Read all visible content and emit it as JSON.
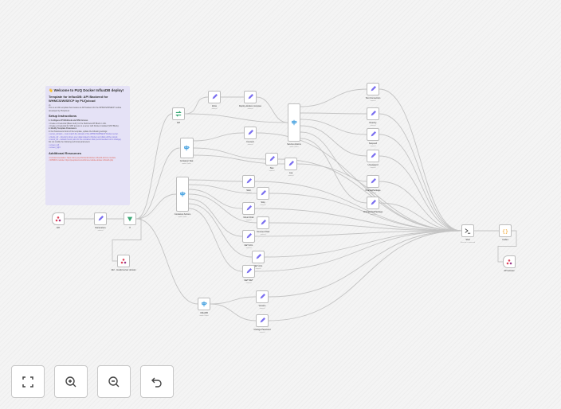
{
  "sticky_note": {
    "title": "👋 Welcome to PUQ Docker InfluxDB deploy!",
    "subtitle": "Template for InfluxDB: API Backend for WHMCS/WISECP by PUQcloud",
    "version": "v1",
    "intro": "This is an n8n template that creates an API backend for the WHMCS/WISECP module developed by PUQcloud.",
    "setup_heading": "Setup Instructions",
    "step1": "1. Configure API Webhook and SSH Access",
    "step1a": "• Create a Credential (Basic Auth) for the Webhook API Block in n8n.",
    "step1b": "• Create a Credential for SSH access to a server with Docker installed (SSH Block).",
    "step2": "2. Modify Template Parameters",
    "step2a": "In the Parameters block of the template, update the following settings:",
    "param1": "• server_domain – must match the domain of the WHMCS/WISECP Docker server.",
    "param2": "• clients_dir – directory where user data related to Docker and disks will be stored.",
    "param3": "• mount_dir – default mount point for the container disk (recommended not to change).",
    "donot": "Do not modify the following technical parameters:",
    "param4": "• screen_left",
    "param5": "• screen_right",
    "resources_heading": "Additional Resources",
    "res1": "• Full documentation: https://doc.puq.info/books/docker-influxdb-whmcs-module",
    "res2": "• WHMCS module: https://puqcloud.com/whmcs-module-docker-influxdb.php"
  },
  "colors": {
    "accent": "#7b6ff0",
    "trigger": "#e0445a",
    "switch": "#3aa876",
    "route": "#4aa3e0",
    "code": "#f0a020"
  },
  "nodes": [
    {
      "id": "api_hook",
      "label": "API",
      "sub": "",
      "icon": "webhook-icon"
    },
    {
      "id": "params",
      "label": "Parameters",
      "sub": "manual",
      "icon": "pencil-icon"
    },
    {
      "id": "if",
      "label": "If",
      "sub": "",
      "icon": "if-icon"
    },
    {
      "id": "invalid",
      "label": "422 - Invalid server domain",
      "sub": "",
      "icon": "webhook-icon"
    },
    {
      "id": "api_switch",
      "label": "API",
      "sub": "",
      "icon": "switch-icon"
    },
    {
      "id": "container_info",
      "label": "Container Stat",
      "sub": "mode: Rules",
      "icon": "route-icon"
    },
    {
      "id": "container_actions",
      "label": "Container Actions",
      "sub": "mode: Rules",
      "icon": "route-icon"
    },
    {
      "id": "inline",
      "label": "Inline",
      "sub": "manual",
      "icon": "pencil-icon"
    },
    {
      "id": "deploy",
      "label": "Deploy-docker-compose",
      "sub": "manual",
      "icon": "pencil-icon"
    },
    {
      "id": "server_actions",
      "label": "Service Actions",
      "sub": "mode: Rules",
      "icon": "route-icon"
    },
    {
      "id": "connect",
      "label": "Connect",
      "sub": "manual",
      "icon": "pencil-icon"
    },
    {
      "id": "stat",
      "label": "Stat",
      "sub": "manual",
      "icon": "pencil-icon"
    },
    {
      "id": "log",
      "label": "Log",
      "sub": "manual",
      "icon": "pencil-icon"
    },
    {
      "id": "start",
      "label": "Start",
      "sub": "manual",
      "icon": "pencil-icon"
    },
    {
      "id": "stop",
      "label": "Stop",
      "sub": "manual",
      "icon": "pencil-icon"
    },
    {
      "id": "mount_disk",
      "label": "Mount Disk",
      "sub": "manual",
      "icon": "pencil-icon"
    },
    {
      "id": "unmount",
      "label": "Unmount Disk",
      "sub": "manual",
      "icon": "pencil-icon"
    },
    {
      "id": "get_acl",
      "label": "GET ACL",
      "sub": "manual",
      "icon": "pencil-icon"
    },
    {
      "id": "set_acl",
      "label": "SET ACL",
      "sub": "manual",
      "icon": "pencil-icon"
    },
    {
      "id": "get_net",
      "label": "GET NET",
      "sub": "manual",
      "icon": "pencil-icon"
    },
    {
      "id": "influxdb",
      "label": "InfluxDB",
      "sub": "mode: Rules",
      "icon": "route-icon"
    },
    {
      "id": "version",
      "label": "Version",
      "sub": "manual",
      "icon": "pencil-icon"
    },
    {
      "id": "change_pw",
      "label": "Change Password",
      "sub": "manual",
      "icon": "pencil-icon"
    },
    {
      "id": "test_conn",
      "label": "Test Connection",
      "sub": "manual",
      "icon": "pencil-icon"
    },
    {
      "id": "destroy",
      "label": "Destroy",
      "sub": "manual",
      "icon": "pencil-icon"
    },
    {
      "id": "suspend",
      "label": "Suspend",
      "sub": "manual",
      "icon": "pencil-icon"
    },
    {
      "id": "unsuspend",
      "label": "Unsuspend",
      "sub": "manual",
      "icon": "pencil-icon"
    },
    {
      "id": "change_pkg",
      "label": "ChangePackage",
      "sub": "manual",
      "icon": "pencil-icon"
    },
    {
      "id": "change_pkg2",
      "label": "ChangeOwnPackage",
      "sub": "manual",
      "icon": "pencil-icon"
    },
    {
      "id": "ssh",
      "label": "SSH",
      "sub": "Execute a command",
      "icon": "terminal-icon"
    },
    {
      "id": "code",
      "label": "Code1",
      "sub": "",
      "icon": "code-icon"
    },
    {
      "id": "answer",
      "label": "API answer",
      "sub": "",
      "icon": "webhook-icon"
    }
  ],
  "edges": [
    [
      "api_hook",
      "params"
    ],
    [
      "params",
      "if"
    ],
    [
      "if",
      "invalid"
    ],
    [
      "if",
      "api_switch"
    ],
    [
      "if",
      "container_info"
    ],
    [
      "if",
      "container_actions"
    ],
    [
      "if",
      "influxdb"
    ],
    [
      "api_switch",
      "inline"
    ],
    [
      "inline",
      "deploy"
    ],
    [
      "deploy",
      "server_actions"
    ],
    [
      "api_switch",
      "server_actions"
    ],
    [
      "container_info",
      "connect"
    ],
    [
      "container_info",
      "stat"
    ],
    [
      "container_info",
      "log"
    ],
    [
      "container_actions",
      "start"
    ],
    [
      "container_actions",
      "stop"
    ],
    [
      "container_actions",
      "mount_disk"
    ],
    [
      "container_actions",
      "unmount"
    ],
    [
      "container_actions",
      "get_acl"
    ],
    [
      "container_actions",
      "set_acl"
    ],
    [
      "container_actions",
      "get_net"
    ],
    [
      "influxdb",
      "version"
    ],
    [
      "influxdb",
      "change_pw"
    ],
    [
      "server_actions",
      "test_conn"
    ],
    [
      "server_actions",
      "destroy"
    ],
    [
      "server_actions",
      "suspend"
    ],
    [
      "server_actions",
      "unsuspend"
    ],
    [
      "server_actions",
      "change_pkg"
    ],
    [
      "server_actions",
      "change_pkg2"
    ],
    [
      "test_conn",
      "ssh"
    ],
    [
      "destroy",
      "ssh"
    ],
    [
      "suspend",
      "ssh"
    ],
    [
      "unsuspend",
      "ssh"
    ],
    [
      "change_pkg",
      "ssh"
    ],
    [
      "change_pkg2",
      "ssh"
    ],
    [
      "connect",
      "ssh"
    ],
    [
      "stat",
      "ssh"
    ],
    [
      "log",
      "ssh"
    ],
    [
      "start",
      "ssh"
    ],
    [
      "stop",
      "ssh"
    ],
    [
      "mount_disk",
      "ssh"
    ],
    [
      "unmount",
      "ssh"
    ],
    [
      "get_acl",
      "ssh"
    ],
    [
      "set_acl",
      "ssh"
    ],
    [
      "get_net",
      "ssh"
    ],
    [
      "version",
      "ssh"
    ],
    [
      "change_pw",
      "ssh"
    ],
    [
      "ssh",
      "code"
    ],
    [
      "code",
      "answer"
    ]
  ],
  "controls": {
    "fit": "Fit view",
    "zoom_in": "Zoom in",
    "zoom_out": "Zoom out",
    "undo": "Undo"
  }
}
